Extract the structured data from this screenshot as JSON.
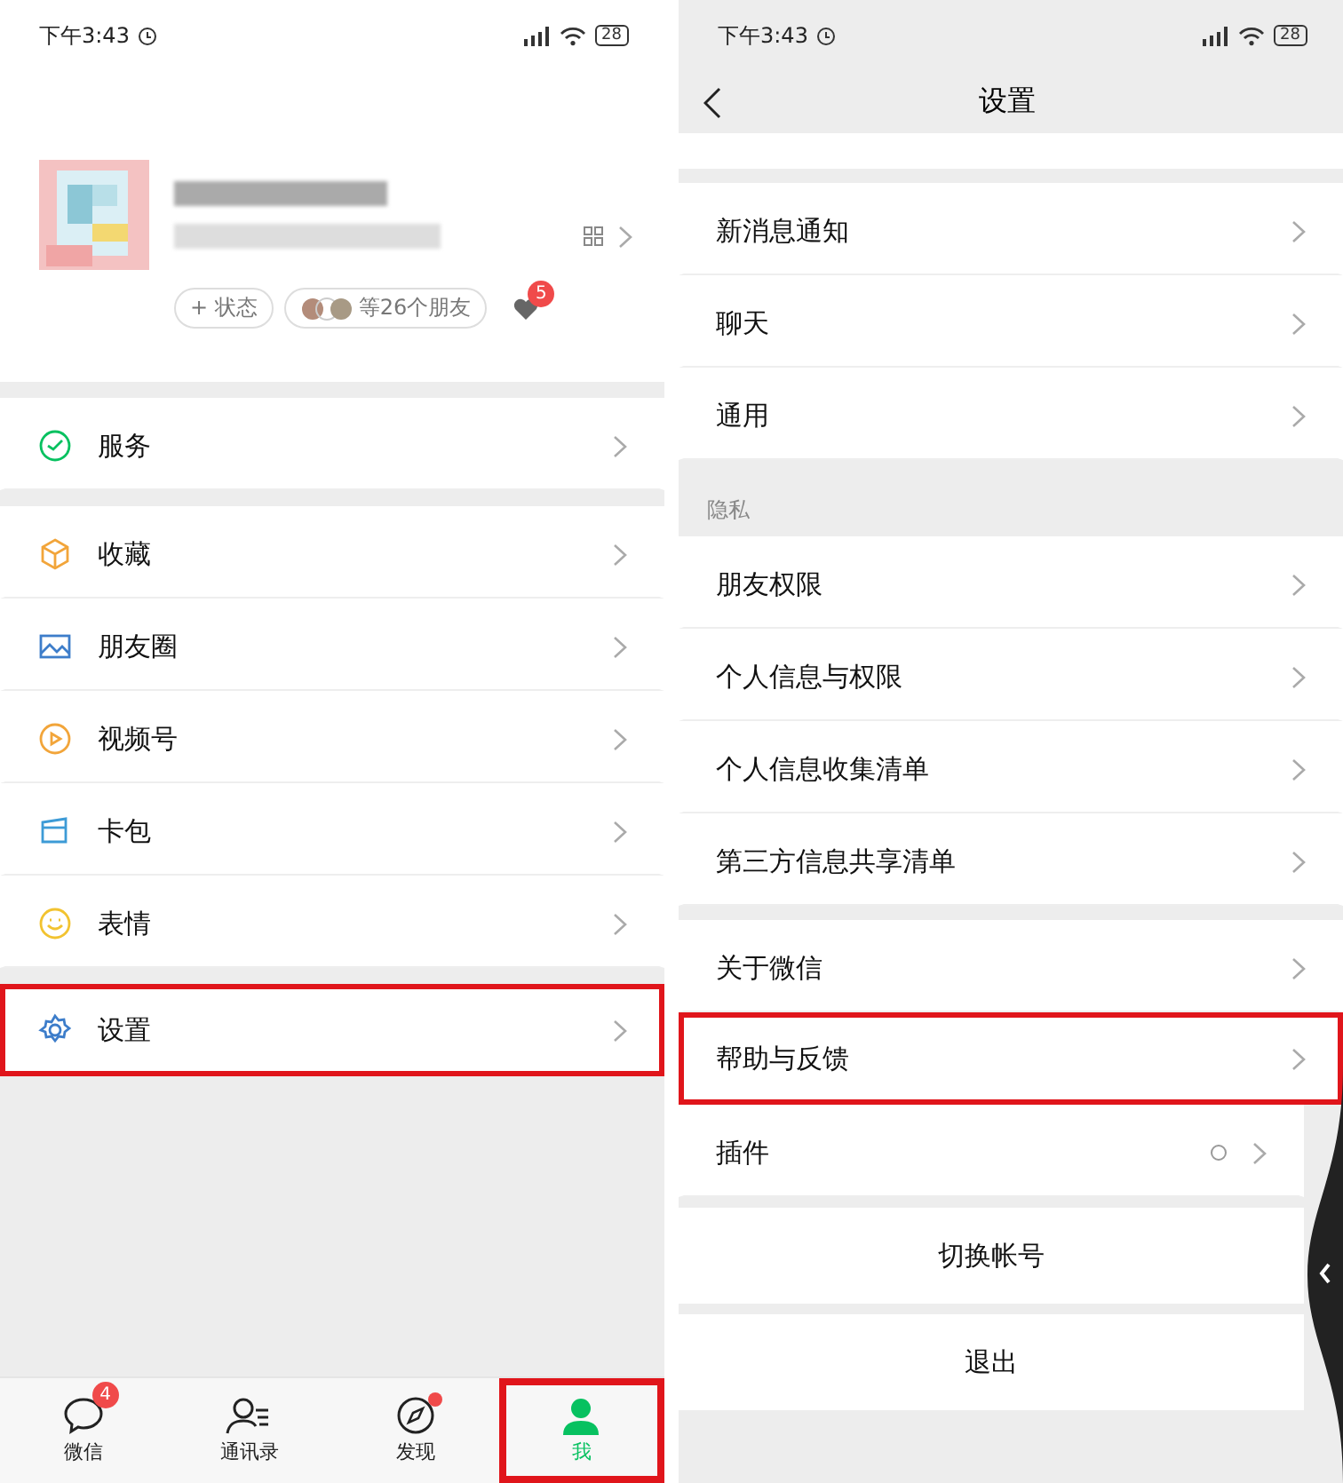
{
  "me_screen": {
    "status_bar": {
      "time": "下午3:43",
      "battery": "28"
    },
    "profile": {
      "status_chip": "+ 状态",
      "friends_chip": "等26个朋友",
      "notification_badge": "5"
    },
    "menu_groups": [
      [
        {
          "label": "服务",
          "highlighted": false
        }
      ],
      [
        {
          "label": "收藏",
          "highlighted": false
        },
        {
          "label": "朋友圈",
          "highlighted": false
        },
        {
          "label": "视频号",
          "highlighted": false
        },
        {
          "label": "卡包",
          "highlighted": false
        },
        {
          "label": "表情",
          "highlighted": false
        }
      ],
      [
        {
          "label": "设置",
          "highlighted": true
        }
      ]
    ],
    "tab_bar": [
      {
        "label": "微信",
        "badge": "4",
        "dot": false,
        "selected": false,
        "highlighted": false
      },
      {
        "label": "通讯录",
        "dot": false,
        "selected": false,
        "highlighted": false
      },
      {
        "label": "发现",
        "dot": true,
        "selected": false,
        "highlighted": false
      },
      {
        "label": "我",
        "dot": false,
        "selected": true,
        "highlighted": true
      }
    ]
  },
  "settings_screen": {
    "status_bar": {
      "time": "下午3:43",
      "battery": "28"
    },
    "title": "设置",
    "sections": [
      {
        "items": [
          {
            "label": "新消息通知",
            "highlighted": false
          },
          {
            "label": "聊天",
            "highlighted": false
          },
          {
            "label": "通用",
            "highlighted": false
          }
        ]
      },
      {
        "header": "隐私",
        "items": [
          {
            "label": "朋友权限",
            "highlighted": false
          },
          {
            "label": "个人信息与权限",
            "highlighted": false
          },
          {
            "label": "个人信息收集清单",
            "highlighted": false
          },
          {
            "label": "第三方信息共享清单",
            "highlighted": false
          }
        ]
      },
      {
        "items": [
          {
            "label": "关于微信",
            "highlighted": false
          },
          {
            "label": "帮助与反馈",
            "highlighted": true
          },
          {
            "label": "插件",
            "highlighted": false
          }
        ]
      }
    ],
    "actions": [
      "切换帐号",
      "退出"
    ]
  }
}
